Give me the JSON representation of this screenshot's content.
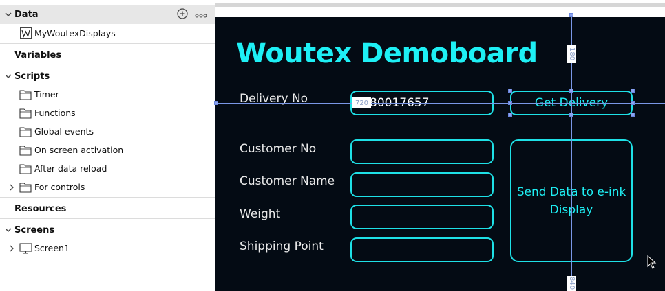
{
  "sidebar": {
    "data_section": {
      "title": "Data",
      "items": [
        "MyWoutexDisplays"
      ]
    },
    "variables_section": {
      "title": "Variables"
    },
    "scripts_section": {
      "title": "Scripts",
      "items": [
        "Timer",
        "Functions",
        "Global events",
        "On screen activation",
        "After data reload",
        "For controls"
      ]
    },
    "resources_section": {
      "title": "Resources"
    },
    "screens_section": {
      "title": "Screens",
      "items": [
        "Screen1"
      ]
    }
  },
  "board": {
    "title": "Woutex Demoboard",
    "fields": [
      {
        "label": "Delivery No",
        "value": "80017657"
      },
      {
        "label": "Customer No",
        "value": ""
      },
      {
        "label": "Customer Name",
        "value": ""
      },
      {
        "label": "Weight",
        "value": ""
      },
      {
        "label": "Shipping Point",
        "value": ""
      }
    ],
    "get_delivery_label": "Get Delivery",
    "send_data_label": "Send Data to e-ink Display"
  },
  "guides": {
    "horizontal_readout": "720",
    "vertical_top_readout": "180",
    "vertical_bottom_readout": "840"
  },
  "colors": {
    "accent": "#1ef0f5",
    "screen_bg": "#040b14",
    "guide": "#7a97e6",
    "sidebar_highlight": "#e7e7e7"
  },
  "icons": {
    "add": "plus-circle-icon",
    "more": "more-dots-icon",
    "datasource": "datasource-w-icon",
    "folder": "folder-icon",
    "screen": "monitor-icon",
    "expand": "chevron-right-icon",
    "collapse": "chevron-down-icon"
  }
}
